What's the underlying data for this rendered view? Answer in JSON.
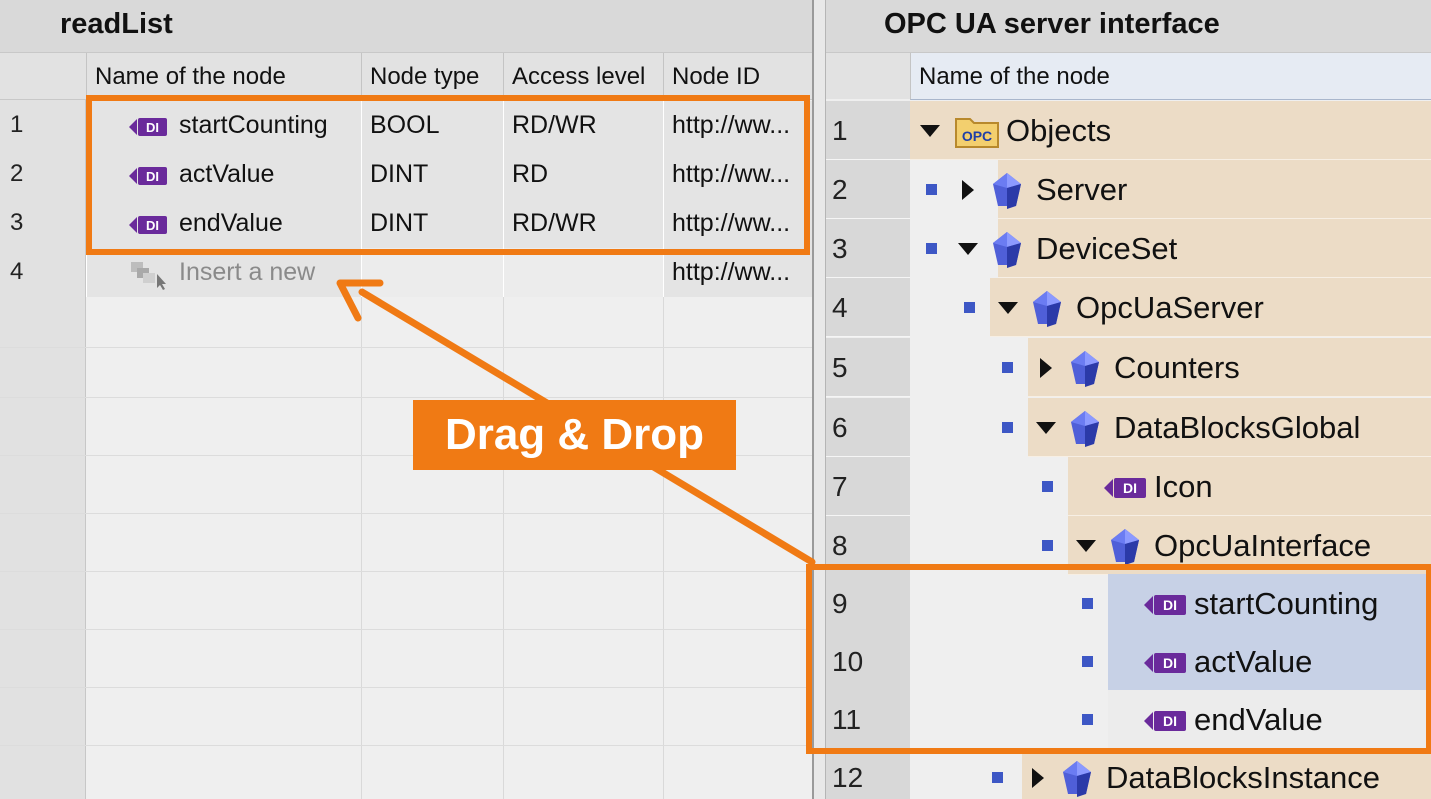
{
  "left_panel": {
    "title": "readList",
    "columns": [
      "Name of the node",
      "Node type",
      "Access level",
      "Node ID"
    ],
    "rows": [
      {
        "num": "1",
        "name": "startCounting",
        "type": "BOOL",
        "access": "RD/WR",
        "id": "http://ww..."
      },
      {
        "num": "2",
        "name": "actValue",
        "type": "DINT",
        "access": "RD",
        "id": "http://ww..."
      },
      {
        "num": "3",
        "name": "endValue",
        "type": "DINT",
        "access": "RD/WR",
        "id": "http://ww..."
      },
      {
        "num": "4",
        "name": "Insert a new",
        "type": "",
        "access": "",
        "id": "http://ww..."
      }
    ]
  },
  "right_panel": {
    "title": "OPC UA server interface",
    "column": "Name of the node",
    "rows": [
      {
        "num": "1",
        "label": "Objects",
        "icon": "opc-folder-icon",
        "expander": "expanded"
      },
      {
        "num": "2",
        "label": "Server",
        "icon": "object-icon",
        "expander": "collapsed"
      },
      {
        "num": "3",
        "label": "DeviceSet",
        "icon": "object-icon",
        "expander": "expanded"
      },
      {
        "num": "4",
        "label": "OpcUaServer",
        "icon": "object-icon",
        "expander": "expanded"
      },
      {
        "num": "5",
        "label": "Counters",
        "icon": "object-icon",
        "expander": "collapsed"
      },
      {
        "num": "6",
        "label": "DataBlocksGlobal",
        "icon": "object-icon",
        "expander": "expanded"
      },
      {
        "num": "7",
        "label": "Icon",
        "icon": "variable-icon",
        "expander": "none"
      },
      {
        "num": "8",
        "label": "OpcUaInterface",
        "icon": "object-icon",
        "expander": "expanded"
      },
      {
        "num": "9",
        "label": "startCounting",
        "icon": "variable-icon",
        "expander": "none",
        "selected": true
      },
      {
        "num": "10",
        "label": "actValue",
        "icon": "variable-icon",
        "expander": "none",
        "selected": true
      },
      {
        "num": "11",
        "label": "endValue",
        "icon": "variable-icon",
        "expander": "none"
      },
      {
        "num": "12",
        "label": "DataBlocksInstance",
        "icon": "object-icon",
        "expander": "collapsed"
      }
    ]
  },
  "annotation": {
    "label": "Drag & Drop",
    "accent_color": "#f07a14"
  },
  "icons": {
    "variable_badge_text": "DI",
    "folder_badge_text": "OPC"
  }
}
